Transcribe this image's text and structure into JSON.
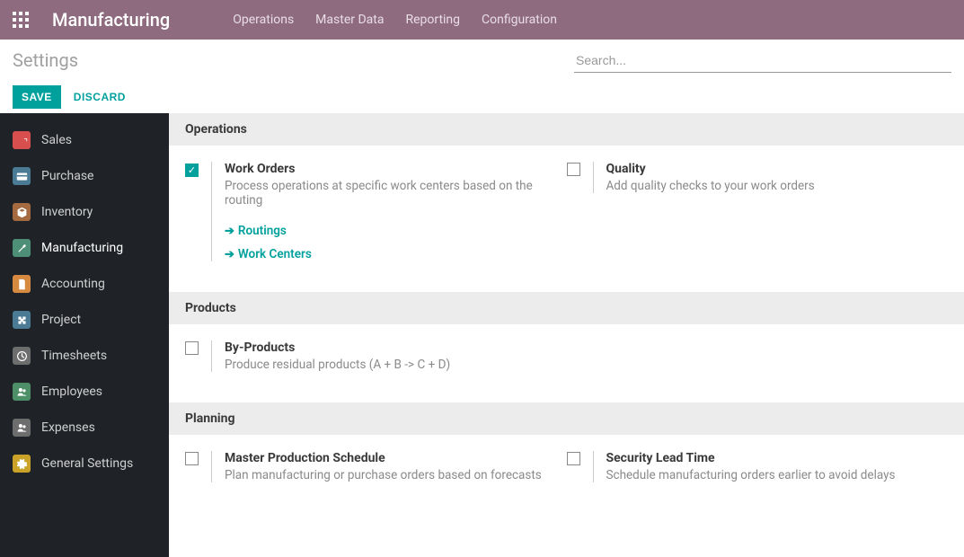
{
  "navbar": {
    "title": "Manufacturing",
    "menu": [
      "Operations",
      "Master Data",
      "Reporting",
      "Configuration"
    ]
  },
  "toolbar": {
    "page_title": "Settings",
    "search_placeholder": "Search..."
  },
  "actionbar": {
    "save_label": "SAVE",
    "discard_label": "DISCARD"
  },
  "sidebar": {
    "items": [
      {
        "label": "Sales",
        "icon": "sales"
      },
      {
        "label": "Purchase",
        "icon": "purchase"
      },
      {
        "label": "Inventory",
        "icon": "inventory"
      },
      {
        "label": "Manufacturing",
        "icon": "manufacturing",
        "active": true
      },
      {
        "label": "Accounting",
        "icon": "accounting"
      },
      {
        "label": "Project",
        "icon": "project"
      },
      {
        "label": "Timesheets",
        "icon": "timesheets"
      },
      {
        "label": "Employees",
        "icon": "employees"
      },
      {
        "label": "Expenses",
        "icon": "expenses"
      },
      {
        "label": "General Settings",
        "icon": "general"
      }
    ]
  },
  "sections": {
    "operations": {
      "header": "Operations",
      "work_orders": {
        "title": "Work Orders",
        "desc": "Process operations at specific work centers based on the routing",
        "checked": true,
        "links": [
          "Routings",
          "Work Centers"
        ]
      },
      "quality": {
        "title": "Quality",
        "desc": "Add quality checks to your work orders",
        "checked": false
      }
    },
    "products": {
      "header": "Products",
      "by_products": {
        "title": "By-Products",
        "desc": "Produce residual products (A + B -> C + D)",
        "checked": false
      }
    },
    "planning": {
      "header": "Planning",
      "mps": {
        "title": "Master Production Schedule",
        "desc": "Plan manufacturing or purchase orders based on forecasts",
        "checked": false
      },
      "security": {
        "title": "Security Lead Time",
        "desc": "Schedule manufacturing orders earlier to avoid delays",
        "checked": false
      }
    }
  }
}
